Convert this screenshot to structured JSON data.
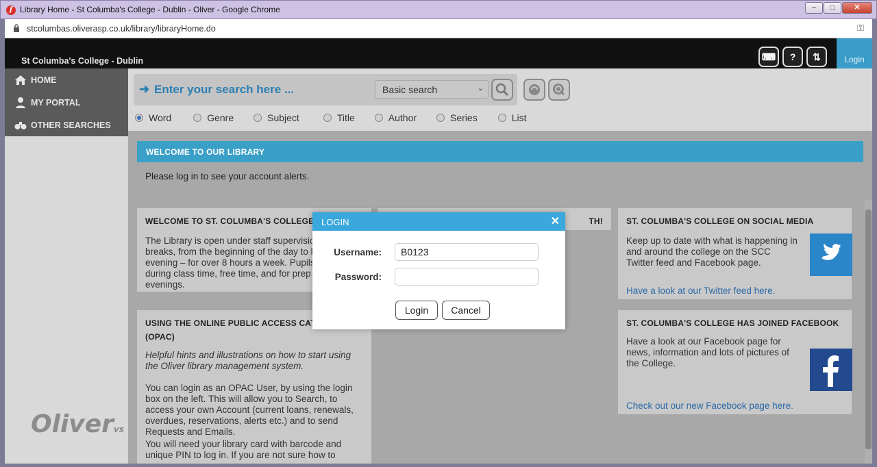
{
  "window": {
    "title": "Library Home - St Columba's College - Dublin - Oliver - Google Chrome",
    "url": "stcolumbas.oliverasp.co.uk/library/libraryHome.do"
  },
  "header": {
    "college_name": "St Columba's College - Dublin",
    "login_label": "Login"
  },
  "sidebar": {
    "items": [
      {
        "label": "HOME",
        "icon": "home-icon"
      },
      {
        "label": "MY PORTAL",
        "icon": "user-icon"
      },
      {
        "label": "OTHER SEARCHES",
        "icon": "binoculars-icon"
      }
    ]
  },
  "search": {
    "placeholder": "Enter your search here ...",
    "mode": "Basic search",
    "types": [
      "Word",
      "Genre",
      "Subject",
      "Title",
      "Author",
      "Series",
      "List"
    ],
    "selected_type": "Word"
  },
  "main": {
    "welcome_title": "WELCOME TO OUR LIBRARY",
    "alert_text": "Please log in to see your account alerts.",
    "panels": {
      "welcome": {
        "title": "WELCOME TO ST. COLUMBA'S COLLEGE",
        "body": "The Library is open under staff supervision from brief breaks, from the beginning of the day to late in the evening – for over 8 hours a week. Pupils use it during class time, free time, and for prep in the evenings."
      },
      "middle_title": "TH!",
      "opac": {
        "title": "USING THE ONLINE PUBLIC ACCESS CATALOGUE (OPAC)",
        "intro": "Helpful hints and illustrations on how to start using the Oliver library management system.",
        "body1": "You can login as an OPAC User, by using the login box on the left. This will allow you to Search, to access your own Account (current loans, renewals, overdues, reservations, alerts etc.) and to send Requests and Emails.",
        "body2": "You will need your library card with barcode and unique PIN to log in. If you are not sure how to"
      },
      "social": {
        "title": "ST. COLUMBA'S COLLEGE ON SOCIAL MEDIA",
        "body": "Keep up to date with what is happening in and around the college on the SCC Twitter feed and Facebook page.",
        "link": "Have a look at our Twitter feed here."
      },
      "facebook": {
        "title": "ST. COLUMBA'S COLLEGE HAS JOINED FACEBOOK",
        "body": "Have a look at our Facebook page for news, information and lots of pictures of the College.",
        "link": "Check out our new Facebook page here."
      }
    },
    "logo_text": "Oliver",
    "logo_suffix": "vs"
  },
  "login_modal": {
    "title": "LOGIN",
    "username_label": "Username:",
    "username_value": "B0123",
    "password_label": "Password:",
    "password_value": "",
    "login_button": "Login",
    "cancel_button": "Cancel"
  }
}
